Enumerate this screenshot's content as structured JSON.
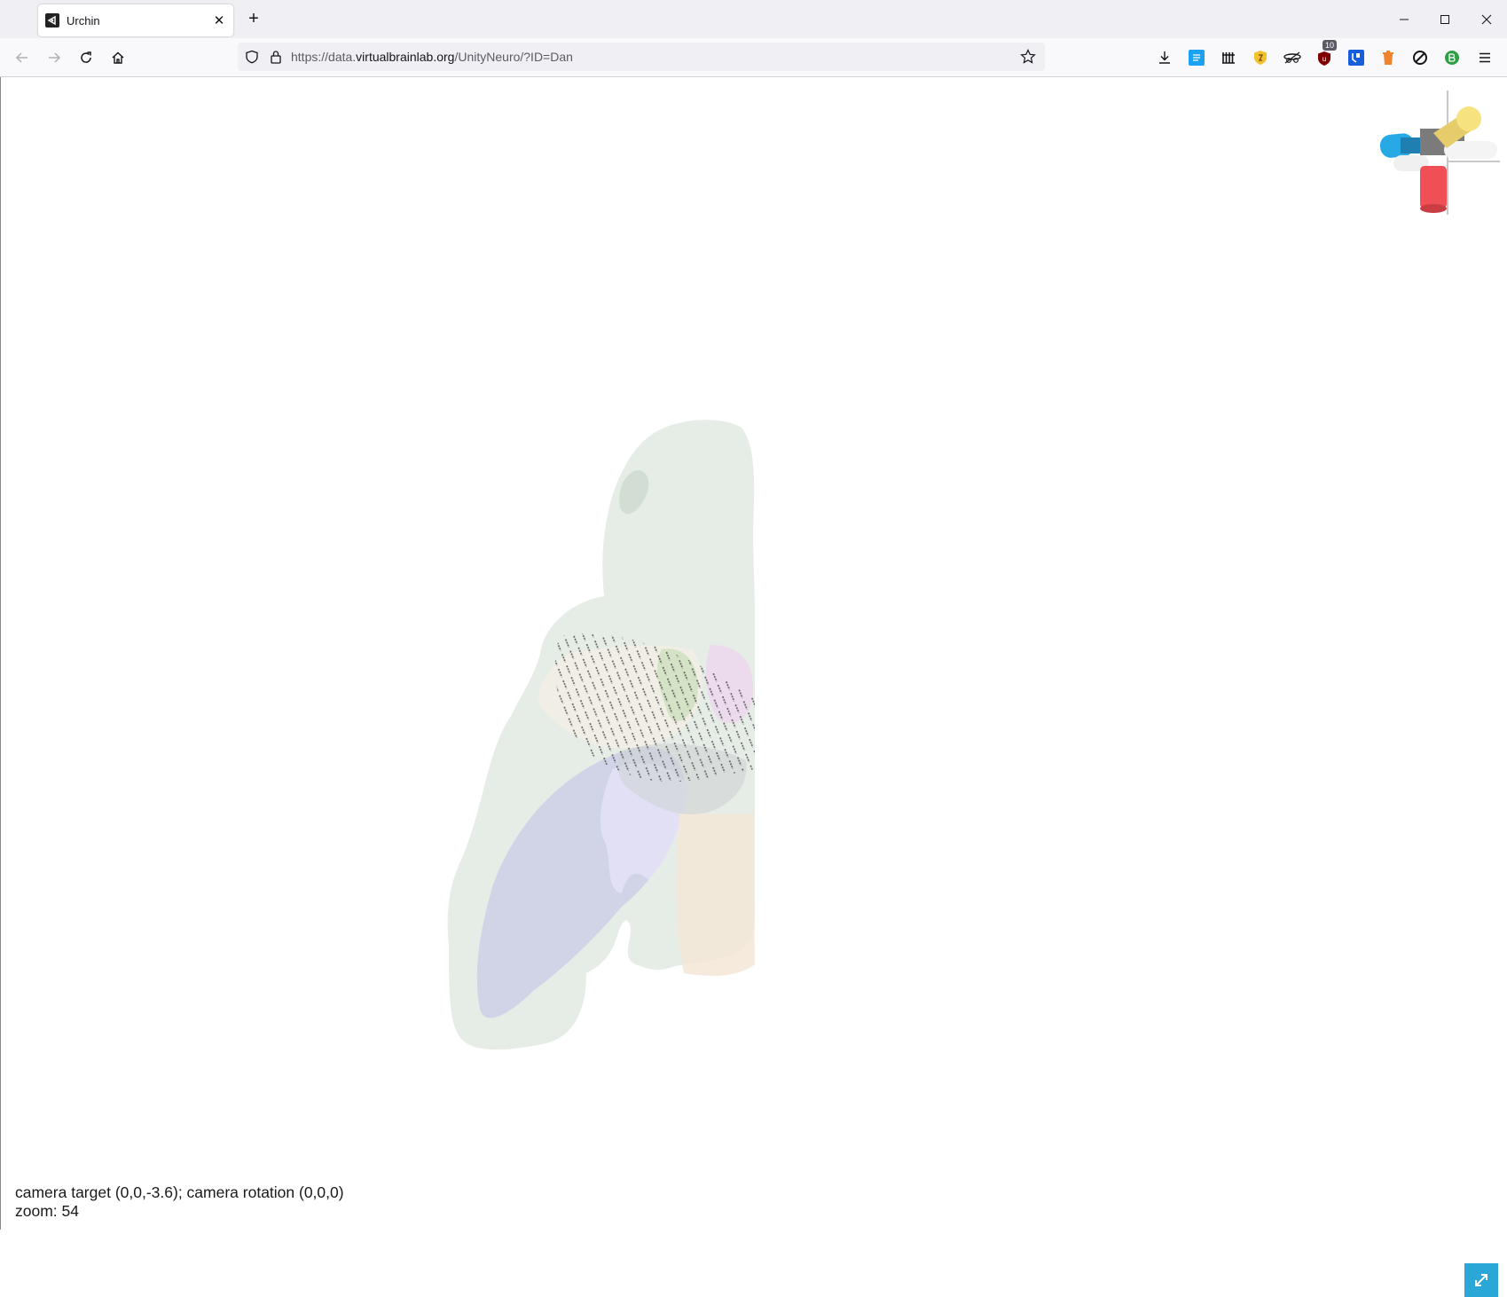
{
  "browser": {
    "tab_title": "Urchin",
    "tab_close_label": "✕",
    "new_tab_label": "+",
    "url_scheme": "https://",
    "url_sub": "data.",
    "url_host": "virtualbrainlab.org",
    "url_path": "/UnityNeuro/?ID=Dan",
    "extension_badge": "10"
  },
  "viewer": {
    "status_line1": "camera target (0,0,-3.6); camera rotation (0,0,0)",
    "status_line2": "zoom: 54"
  },
  "colors": {
    "axis_blue": "#27a9e6",
    "axis_yellow": "#f6e27e",
    "axis_red": "#ef4f55",
    "axis_white": "#f2f2f2",
    "axis_gray": "#6f6f6f",
    "fullscreen_button": "#2aa7d6"
  }
}
